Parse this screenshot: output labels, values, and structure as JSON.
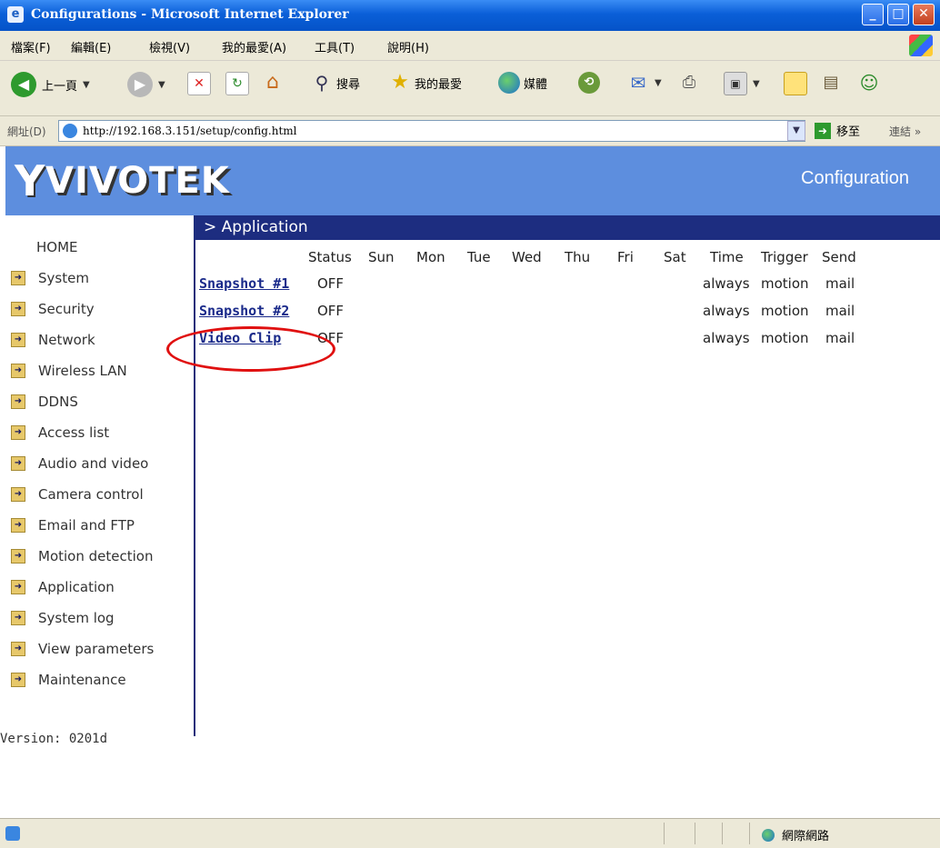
{
  "window": {
    "title": "Configurations - Microsoft Internet Explorer"
  },
  "menu": {
    "items": [
      "檔案(F)",
      "編輯(E)",
      "檢視(V)",
      "我的最愛(A)",
      "工具(T)",
      "說明(H)"
    ]
  },
  "toolbar": {
    "back_label": "上一頁",
    "search_label": "搜尋",
    "favorites_label": "我的最愛",
    "media_label": "媒體"
  },
  "addressbar": {
    "label": "網址(D)",
    "url": "http://192.168.3.151/setup/config.html",
    "go_label": "移至",
    "links_label": "連結"
  },
  "page": {
    "brand": "VIVOTEK",
    "header_title": "Configuration",
    "section_title": "> Application",
    "sidebar": {
      "home": "HOME",
      "items": [
        "System",
        "Security",
        "Network",
        "Wireless LAN",
        "DDNS",
        "Access list",
        "Audio and video",
        "Camera control",
        "Email and FTP",
        "Motion detection",
        "Application",
        "System log",
        "View parameters",
        "Maintenance"
      ],
      "version": "Version: 0201d"
    },
    "table": {
      "headers": [
        "Status",
        "Sun",
        "Mon",
        "Tue",
        "Wed",
        "Thu",
        "Fri",
        "Sat",
        "Time",
        "Trigger",
        "Send"
      ],
      "rows": [
        {
          "name": "Snapshot #1",
          "status": "OFF",
          "time": "always",
          "trigger": "motion",
          "send": "mail"
        },
        {
          "name": "Snapshot #2",
          "status": "OFF",
          "time": "always",
          "trigger": "motion",
          "send": "mail"
        },
        {
          "name": "Video Clip",
          "status": "OFF",
          "time": "always",
          "trigger": "motion",
          "send": "mail"
        }
      ]
    }
  },
  "statusbar": {
    "zone": "網際網路"
  },
  "colors": {
    "banner": "#5d8ede",
    "header_bar": "#1d2d80",
    "link": "#1a2a8a",
    "highlight_ring": "#e01010"
  }
}
